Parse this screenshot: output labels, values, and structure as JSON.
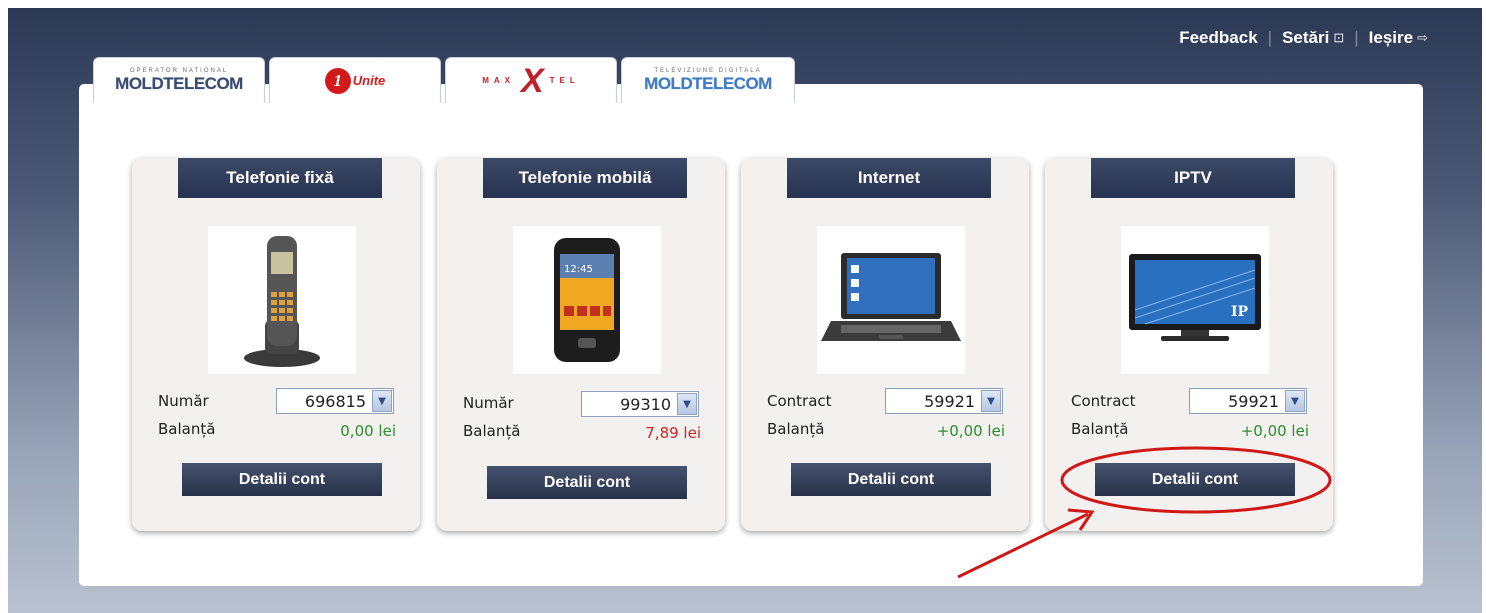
{
  "header_links": {
    "feedback": "Feedback",
    "settings": "Setări",
    "logout": "Ieșire"
  },
  "tabs": [
    {
      "small": "OPERATOR NATIONAL",
      "main": "MOLDTELECOM"
    },
    {
      "one": "1",
      "main": "Unite"
    },
    {
      "left": "MAX",
      "x": "X",
      "right": "TEL"
    },
    {
      "small": "TELEVIZIUNE DIGITALA",
      "main": "MOLDTELECOM"
    }
  ],
  "cards": [
    {
      "title": "Telefonie fixă",
      "field_label": "Număr",
      "field_value": "696815",
      "balance_label": "Balanță",
      "balance": "0,00 lei",
      "balance_color": "#2e8b2e",
      "button": "Detalii cont",
      "icon": "cordless-phone-icon"
    },
    {
      "title": "Telefonie mobilă",
      "field_label": "Număr",
      "field_value": "99310",
      "balance_label": "Balanță",
      "balance": "7,89 lei",
      "balance_color": "#d22424",
      "button": "Detalii cont",
      "icon": "smartphone-icon"
    },
    {
      "title": "Internet",
      "field_label": "Contract",
      "field_value": "59921",
      "balance_label": "Balanță",
      "balance": "+0,00 lei",
      "balance_color": "#2e8b2e",
      "button": "Detalii cont",
      "icon": "laptop-icon"
    },
    {
      "title": "IPTV",
      "field_label": "Contract",
      "field_value": "59921",
      "balance_label": "Balanță",
      "balance": "+0,00 lei",
      "balance_color": "#2e8b2e",
      "button": "Detalii cont",
      "icon": "tv-icon",
      "tv_badge": "IP"
    }
  ],
  "colors": {
    "accent_dark": "#27314a",
    "annotation_red": "#d01818"
  }
}
